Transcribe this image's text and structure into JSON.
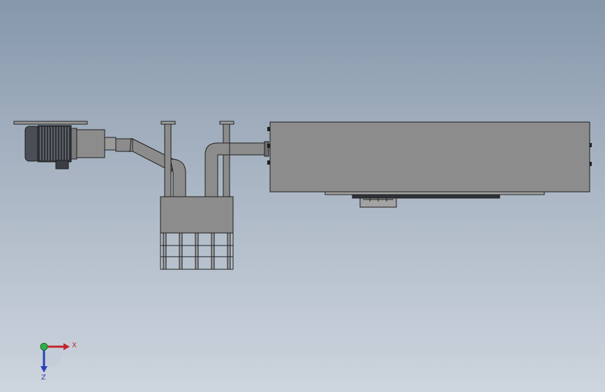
{
  "colors": {
    "background_top": "#8697ab",
    "background_bottom": "#cdd5de",
    "part_fill": "#8c8c8c",
    "part_light": "#a3a3a3",
    "part_dark": "#5e5e5e",
    "outline": "#1e1e1e",
    "x_axis": "#c0262c",
    "y_axis": "#2fb04a",
    "z_axis": "#2a3fb8"
  },
  "triad": {
    "x_label": "X",
    "z_label": "Z"
  }
}
